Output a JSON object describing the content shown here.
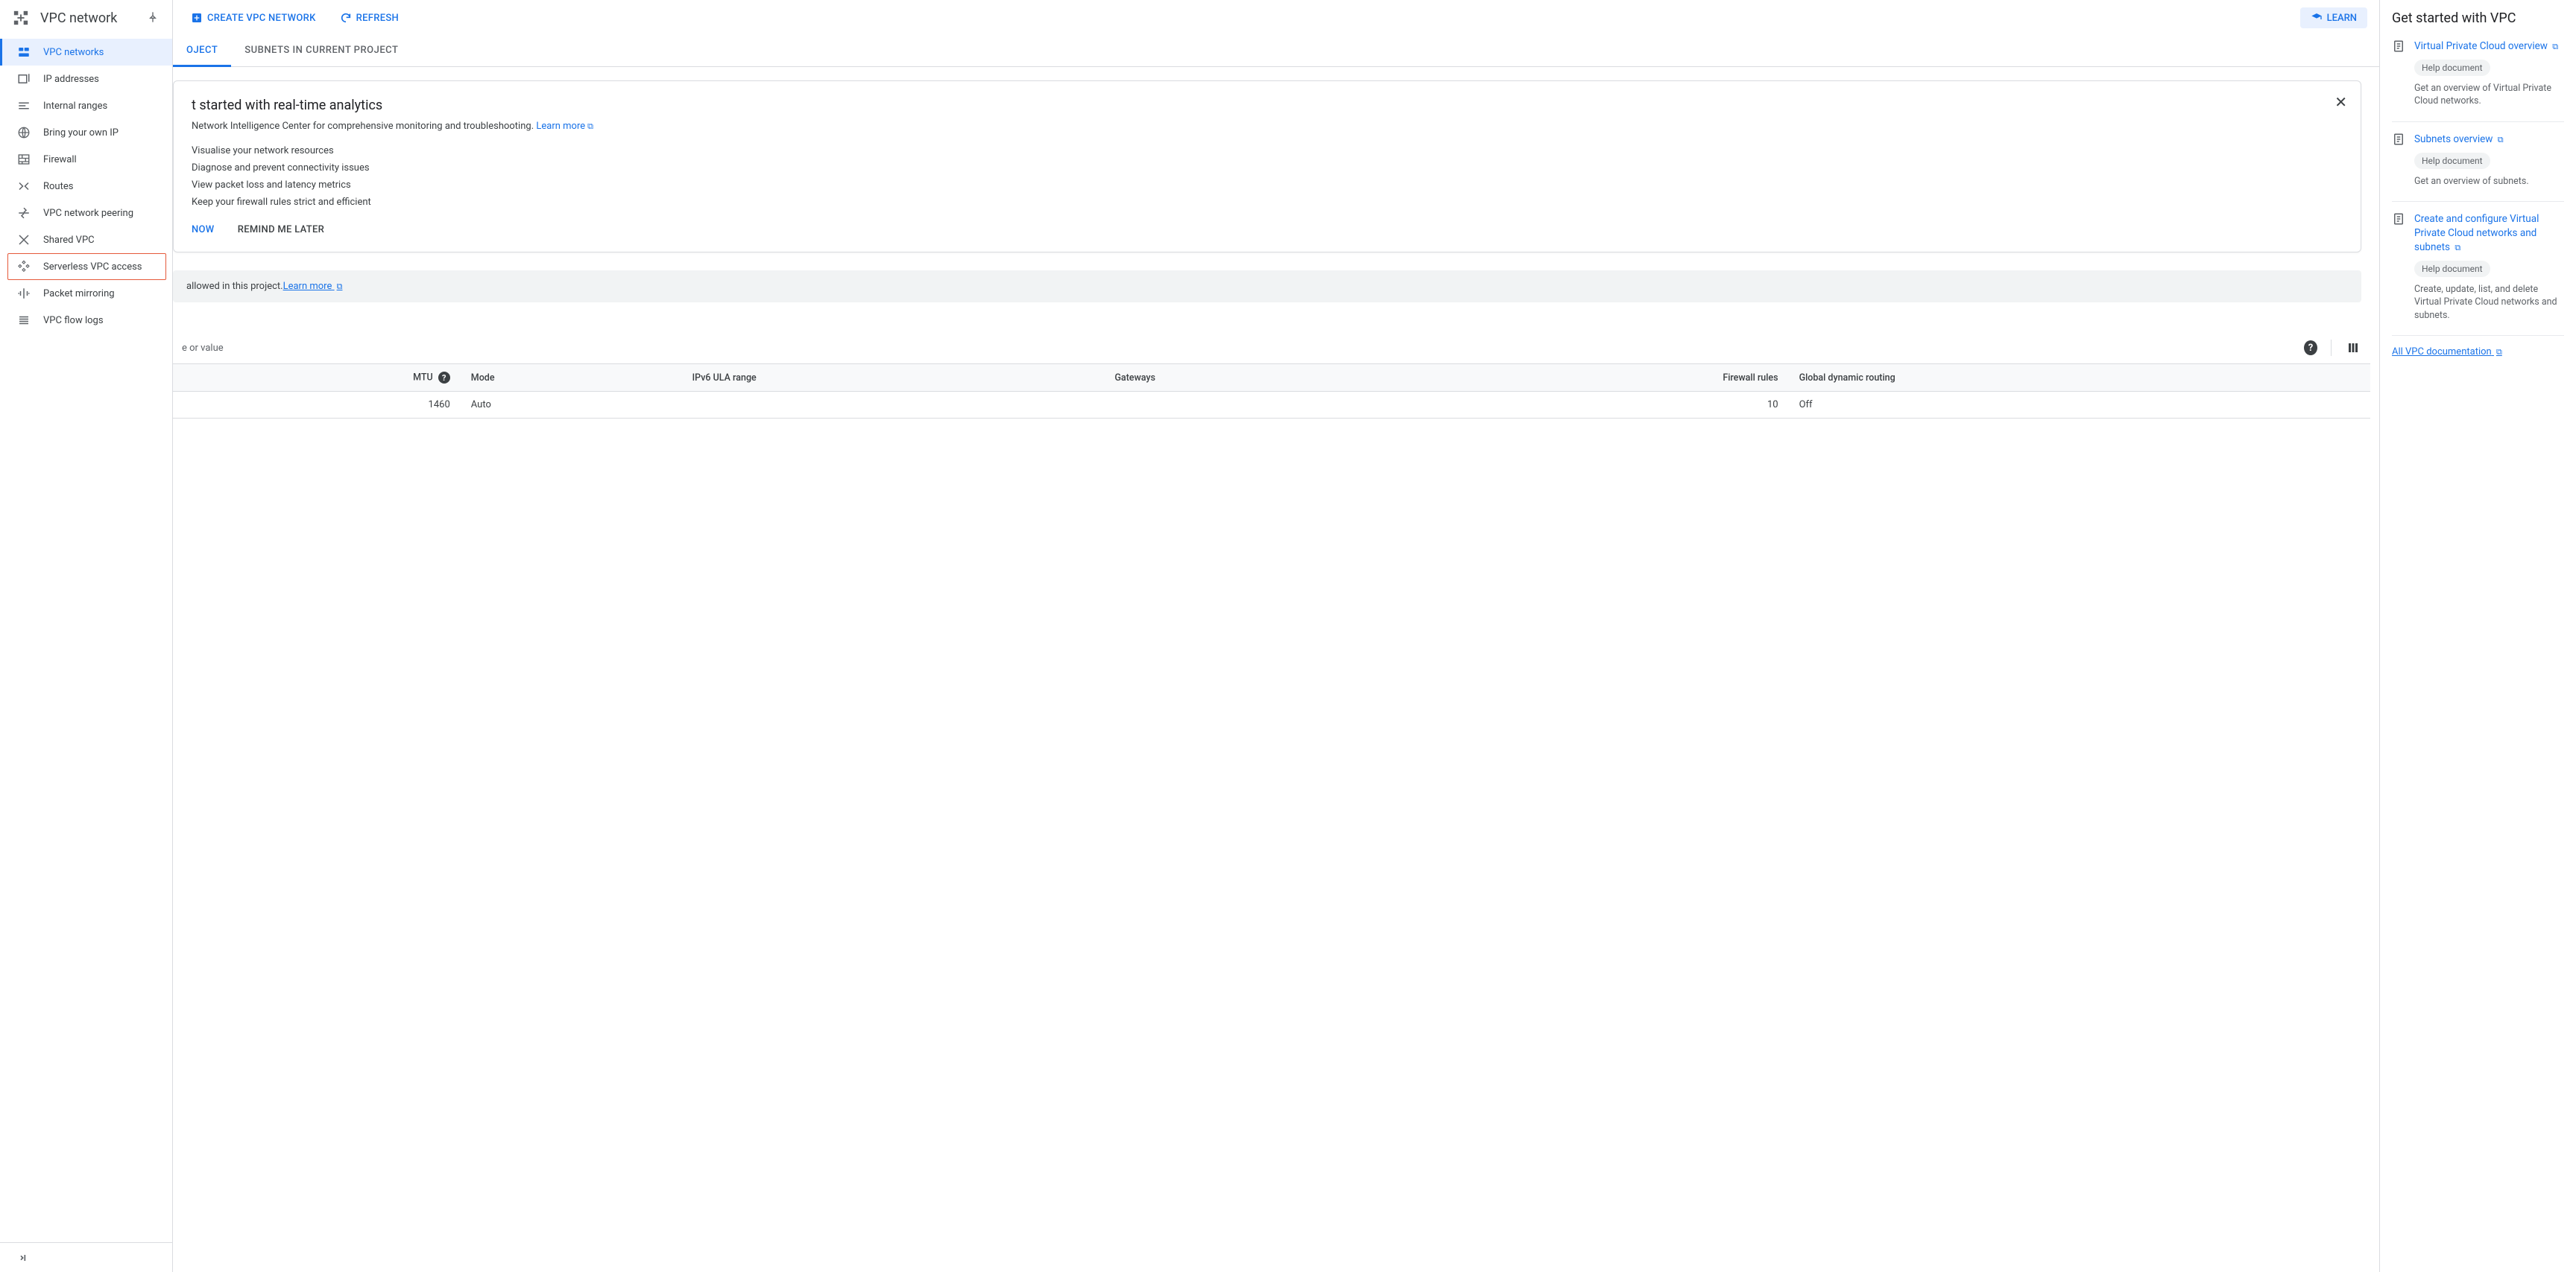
{
  "sidebar": {
    "title": "VPC network",
    "items": [
      {
        "label": "VPC networks"
      },
      {
        "label": "IP addresses"
      },
      {
        "label": "Internal ranges"
      },
      {
        "label": "Bring your own IP"
      },
      {
        "label": "Firewall"
      },
      {
        "label": "Routes"
      },
      {
        "label": "VPC network peering"
      },
      {
        "label": "Shared VPC"
      },
      {
        "label": "Serverless VPC access"
      },
      {
        "label": "Packet mirroring"
      },
      {
        "label": "VPC flow logs"
      }
    ]
  },
  "toolbar": {
    "create": "CREATE VPC NETWORK",
    "refresh": "REFRESH",
    "learn": "LEARN"
  },
  "tabs": {
    "t1": "OJECT",
    "t2": "SUBNETS IN CURRENT PROJECT"
  },
  "promo": {
    "title": "t started with real-time analytics",
    "sub_pre": "Network Intelligence Center for comprehensive monitoring and troubleshooting. ",
    "learn_more": "Learn more",
    "items": [
      "Visualise your network resources",
      "Diagnose and prevent connectivity issues",
      "View packet loss and latency metrics",
      "Keep your firewall rules strict and efficient"
    ],
    "primary": "NOW",
    "secondary": "REMIND ME LATER"
  },
  "notice": {
    "text": "allowed in this project.",
    "link": "Learn more"
  },
  "filter": {
    "placeholder": "e or value"
  },
  "table": {
    "headers": {
      "mtu": "MTU",
      "mode": "Mode",
      "ipv6": "IPv6 ULA range",
      "gateways": "Gateways",
      "firewall": "Firewall rules",
      "routing": "Global dynamic routing"
    },
    "row": {
      "mtu": "1460",
      "mode": "Auto",
      "ipv6": "",
      "gateways": "",
      "firewall": "10",
      "routing": "Off"
    }
  },
  "right_panel": {
    "title": "Get started with VPC",
    "chip": "Help document",
    "items": [
      {
        "link": "Virtual Private Cloud overview",
        "desc": "Get an overview of Virtual Private Cloud networks."
      },
      {
        "link": "Subnets overview",
        "desc": "Get an overview of subnets."
      },
      {
        "link": "Create and configure Virtual Private Cloud networks and subnets",
        "desc": "Create, update, list, and delete Virtual Private Cloud networks and subnets."
      }
    ],
    "all": "All VPC documentation"
  }
}
